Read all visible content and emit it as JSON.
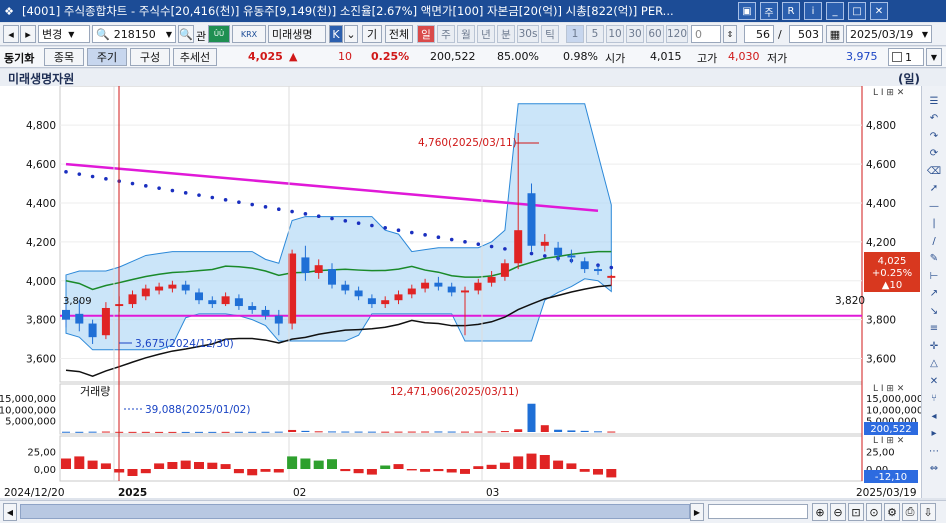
{
  "window": {
    "title": "[4001] 주식종합차트 - 주식수[20,416(천)] 유동주[9,149(천)] 소진율[2.67%] 액면가[100] 자본금[20(억)] 시총[822(억)] PER..."
  },
  "toolbar": {
    "change_label": "변경",
    "stock_code": "218150",
    "gwan_label": "관",
    "krx_label": "KRX",
    "stock_name": "미래생명",
    "k_label": "K",
    "gi_label": "기",
    "all_label": "전체",
    "periods": [
      "일",
      "주",
      "월",
      "년",
      "분",
      "30s",
      "틱"
    ],
    "multipliers": [
      "1",
      "5",
      "10",
      "30",
      "60",
      "120"
    ],
    "zero_value": "0",
    "page_current": "56",
    "page_total": "503",
    "date_value": "2025/03/19",
    "count_value": "1"
  },
  "quote": {
    "sync_label": "동기화",
    "item_btn": "종목",
    "period_btn": "주기",
    "config_btn": "구성",
    "trend_btn": "추세선",
    "price": "4,025",
    "change_arrow": "▲",
    "change": "10",
    "change_rate": "0.25%",
    "volume": "200,522",
    "ratio1": "85.00%",
    "ratio2": "0.98%",
    "open_label": "시가",
    "open": "4,015",
    "high_label": "고가",
    "high": "4,030",
    "low_label": "저가",
    "low": "3,975"
  },
  "chart_header": {
    "stock_full_name": "미래생명자원",
    "period_badge": "(일)"
  },
  "chart_data": [
    {
      "type": "line",
      "title": "",
      "ylim": [
        3500,
        4950
      ],
      "y_ticks": [
        "4,800",
        "4,600",
        "4,400",
        "4,200",
        "4,000",
        "3,800",
        "3,600"
      ],
      "annotations": {
        "high": "4,760(2025/03/11)",
        "low": "3,675(2024/12/30)",
        "ref_line": "3,820",
        "left_ref": "3,809"
      },
      "price_tag": {
        "price": "4,025",
        "change": "+0.25%",
        "arrow": "▲10"
      },
      "candles": [
        {
          "o": 3850,
          "c": 3800,
          "h": 3880,
          "l": 3760
        },
        {
          "o": 3830,
          "c": 3780,
          "h": 3900,
          "l": 3740
        },
        {
          "o": 3780,
          "c": 3710,
          "h": 3800,
          "l": 3675
        },
        {
          "o": 3720,
          "c": 3860,
          "h": 3890,
          "l": 3700
        },
        {
          "o": 3870,
          "c": 3880,
          "h": 3920,
          "l": 3840
        },
        {
          "o": 3880,
          "c": 3930,
          "h": 3950,
          "l": 3860
        },
        {
          "o": 3920,
          "c": 3960,
          "h": 3980,
          "l": 3900
        },
        {
          "o": 3950,
          "c": 3970,
          "h": 3990,
          "l": 3930
        },
        {
          "o": 3960,
          "c": 3980,
          "h": 4000,
          "l": 3940
        },
        {
          "o": 3980,
          "c": 3950,
          "h": 4000,
          "l": 3930
        },
        {
          "o": 3940,
          "c": 3900,
          "h": 3960,
          "l": 3880
        },
        {
          "o": 3900,
          "c": 3880,
          "h": 3920,
          "l": 3860
        },
        {
          "o": 3880,
          "c": 3920,
          "h": 3940,
          "l": 3870
        },
        {
          "o": 3910,
          "c": 3870,
          "h": 3930,
          "l": 3850
        },
        {
          "o": 3870,
          "c": 3850,
          "h": 3890,
          "l": 3830
        },
        {
          "o": 3850,
          "c": 3820,
          "h": 3870,
          "l": 3800
        },
        {
          "o": 3820,
          "c": 3780,
          "h": 3850,
          "l": 3720
        },
        {
          "o": 3780,
          "c": 4140,
          "h": 4160,
          "l": 3750
        },
        {
          "o": 4120,
          "c": 4040,
          "h": 4180,
          "l": 4000
        },
        {
          "o": 4040,
          "c": 4080,
          "h": 4110,
          "l": 4010
        },
        {
          "o": 4060,
          "c": 3980,
          "h": 4090,
          "l": 3960
        },
        {
          "o": 3980,
          "c": 3950,
          "h": 4000,
          "l": 3930
        },
        {
          "o": 3950,
          "c": 3920,
          "h": 3970,
          "l": 3900
        },
        {
          "o": 3910,
          "c": 3880,
          "h": 3930,
          "l": 3860
        },
        {
          "o": 3880,
          "c": 3900,
          "h": 3920,
          "l": 3860
        },
        {
          "o": 3900,
          "c": 3930,
          "h": 3950,
          "l": 3880
        },
        {
          "o": 3930,
          "c": 3960,
          "h": 3980,
          "l": 3910
        },
        {
          "o": 3960,
          "c": 3990,
          "h": 4010,
          "l": 3940
        },
        {
          "o": 3990,
          "c": 3970,
          "h": 4020,
          "l": 3950
        },
        {
          "o": 3970,
          "c": 3940,
          "h": 3990,
          "l": 3920
        },
        {
          "o": 3940,
          "c": 3950,
          "h": 3970,
          "l": 3720
        },
        {
          "o": 3950,
          "c": 3990,
          "h": 4010,
          "l": 3930
        },
        {
          "o": 3990,
          "c": 4020,
          "h": 4050,
          "l": 3970
        },
        {
          "o": 4020,
          "c": 4090,
          "h": 4110,
          "l": 4000
        },
        {
          "o": 4090,
          "c": 4260,
          "h": 4760,
          "l": 4060
        },
        {
          "o": 4450,
          "c": 4180,
          "h": 4500,
          "l": 4150
        },
        {
          "o": 4180,
          "c": 4200,
          "h": 4240,
          "l": 4150
        },
        {
          "o": 4170,
          "c": 4130,
          "h": 4200,
          "l": 4100
        },
        {
          "o": 4130,
          "c": 4120,
          "h": 4160,
          "l": 4090
        },
        {
          "o": 4100,
          "c": 4060,
          "h": 4120,
          "l": 4040
        },
        {
          "o": 4060,
          "c": 4050,
          "h": 4080,
          "l": 4030
        },
        {
          "o": 4015,
          "c": 4025,
          "h": 4030,
          "l": 3975
        }
      ]
    },
    {
      "type": "bar",
      "title": "거래량",
      "ylim": [
        0,
        15000000
      ],
      "y_ticks": [
        "15,000,000",
        "10,000,000",
        "5,000,000"
      ],
      "annotations": {
        "high": "12,471,906(2025/03/11)",
        "low": "39,088(2025/01/02)"
      },
      "price_tag": "200,522",
      "values": [
        120000,
        90000,
        150000,
        200000,
        80000,
        60000,
        70000,
        50000,
        45000,
        39088,
        60000,
        55000,
        70000,
        90000,
        80000,
        100000,
        150000,
        900000,
        500000,
        300000,
        250000,
        200000,
        180000,
        160000,
        150000,
        170000,
        190000,
        210000,
        230000,
        200000,
        180000,
        190000,
        220000,
        400000,
        1200000,
        12471906,
        3000000,
        1000000,
        700000,
        500000,
        300000,
        200522
      ]
    },
    {
      "type": "bar",
      "title": "",
      "ylim": [
        -20,
        40
      ],
      "y_ticks": [
        "25,00",
        "0,00"
      ],
      "price_tag": "-12,10",
      "values": [
        15,
        18,
        12,
        8,
        -5,
        -10,
        -6,
        8,
        10,
        12,
        10,
        9,
        7,
        -6,
        -9,
        -4,
        -5,
        18,
        15,
        12,
        14,
        -3,
        -6,
        -8,
        5,
        7,
        -2,
        -4,
        -3,
        -5,
        -7,
        4,
        6,
        9,
        18,
        22,
        20,
        12,
        8,
        -4,
        -8,
        -12
      ]
    }
  ],
  "x_axis": {
    "labels": [
      "2024/12/20",
      "2025",
      "02",
      "03",
      "2025/03/19"
    ]
  },
  "sidebar_icons": [
    "list-icon",
    "undo-icon",
    "redo-icon",
    "refresh-icon",
    "eraser-icon",
    "pointer-icon",
    "horizontal-line-icon",
    "vertical-line-icon",
    "diagonal-line-icon",
    "pencil-icon",
    "ruler-icon",
    "trend-up-icon",
    "trend-down-icon",
    "channel-icon",
    "cross-line-icon",
    "triangle-icon",
    "cross-icon",
    "fork-icon",
    "arrow-left-icon",
    "arrow-right-icon",
    "more-icon",
    "arrows-icon"
  ]
}
